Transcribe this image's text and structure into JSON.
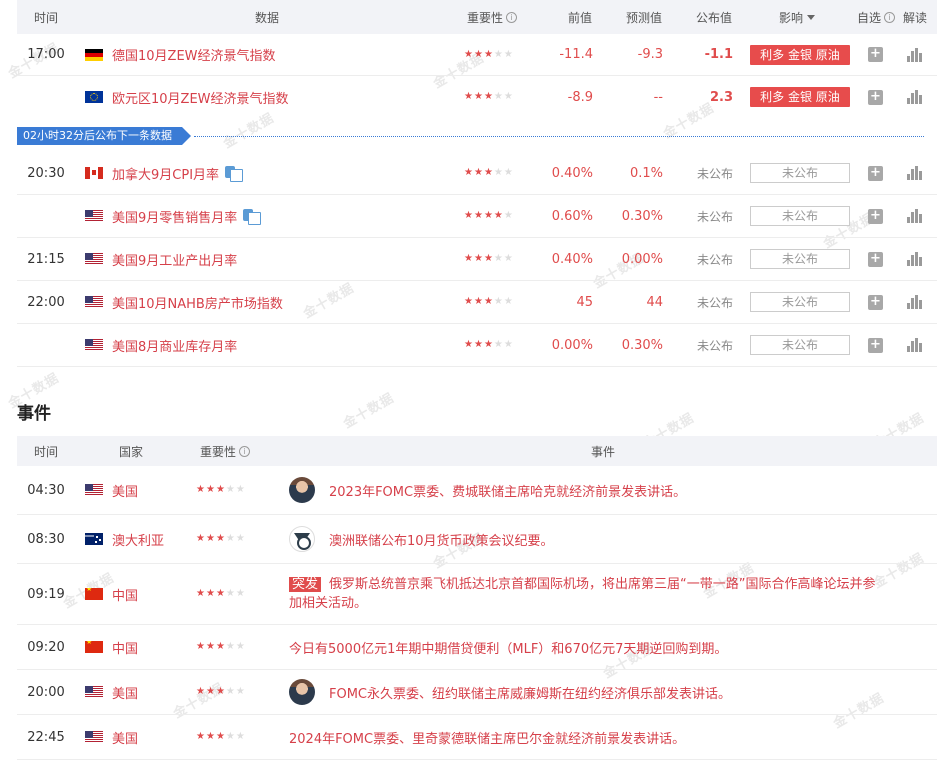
{
  "watermark": "金十数据",
  "data_table": {
    "headers": {
      "time": "时间",
      "data": "数据",
      "importance": "重要性",
      "prev": "前值",
      "forecast": "预测值",
      "actual": "公布值",
      "impact": "影响",
      "watch": "自选",
      "interpret": "解读"
    },
    "rows": [
      {
        "time": "17:00",
        "flag": "de",
        "name": "德国10月ZEW经济景气指数",
        "stars": 3,
        "prev": "-11.4",
        "forecast": "-9.3",
        "actual": "-1.1",
        "impact": "利多 金银 原油",
        "has_doc": false
      },
      {
        "time": "",
        "flag": "eu",
        "name": "欧元区10月ZEW经济景气指数",
        "stars": 3,
        "prev": "-8.9",
        "forecast": "--",
        "actual": "2.3",
        "impact": "利多 金银 原油",
        "has_doc": false
      },
      {
        "time": "20:30",
        "flag": "ca",
        "name": "加拿大9月CPI月率",
        "stars": 3,
        "prev": "0.40%",
        "forecast": "0.1%",
        "actual": "未公布",
        "impact": "未公布",
        "has_doc": true
      },
      {
        "time": "",
        "flag": "us",
        "name": "美国9月零售销售月率",
        "stars": 4,
        "prev": "0.60%",
        "forecast": "0.30%",
        "actual": "未公布",
        "impact": "未公布",
        "has_doc": true
      },
      {
        "time": "21:15",
        "flag": "us",
        "name": "美国9月工业产出月率",
        "stars": 3,
        "prev": "0.40%",
        "forecast": "0.00%",
        "actual": "未公布",
        "impact": "未公布",
        "has_doc": false
      },
      {
        "time": "22:00",
        "flag": "us",
        "name": "美国10月NAHB房产市场指数",
        "stars": 3,
        "prev": "45",
        "forecast": "44",
        "actual": "未公布",
        "impact": "未公布",
        "has_doc": false
      },
      {
        "time": "",
        "flag": "us",
        "name": "美国8月商业库存月率",
        "stars": 3,
        "prev": "0.00%",
        "forecast": "0.30%",
        "actual": "未公布",
        "impact": "未公布",
        "has_doc": false
      }
    ],
    "countdown": "02小时32分后公布下一条数据"
  },
  "events": {
    "title": "事件",
    "headers": {
      "time": "时间",
      "country": "国家",
      "importance": "重要性",
      "event": "事件"
    },
    "rows": [
      {
        "time": "04:30",
        "flag": "us",
        "country": "美国",
        "stars": 3,
        "avatar": "person",
        "flash": "",
        "text": "2023年FOMC票委、费城联储主席哈克就经济前景发表讲话。"
      },
      {
        "time": "08:30",
        "flag": "au",
        "country": "澳大利亚",
        "stars": 3,
        "avatar": "rba",
        "flash": "",
        "text": "澳洲联储公布10月货币政策会议纪要。"
      },
      {
        "time": "09:19",
        "flag": "cn",
        "country": "中国",
        "stars": 3,
        "avatar": "",
        "flash": "突发",
        "text": "俄罗斯总统普京乘飞机抵达北京首都国际机场，将出席第三届“一带一路”国际合作高峰论坛并参",
        "text2": "加相关活动。"
      },
      {
        "time": "09:20",
        "flag": "cn",
        "country": "中国",
        "stars": 3,
        "avatar": "",
        "flash": "",
        "text": "今日有5000亿元1年期中期借贷便利（MLF）和670亿元7天期逆回购到期。"
      },
      {
        "time": "20:00",
        "flag": "us",
        "country": "美国",
        "stars": 3,
        "avatar": "person",
        "flash": "",
        "text": "FOMC永久票委、纽约联储主席威廉姆斯在纽约经济俱乐部发表讲话。"
      },
      {
        "time": "22:45",
        "flag": "us",
        "country": "美国",
        "stars": 3,
        "avatar": "",
        "flash": "",
        "text": "2024年FOMC票委、里奇蒙德联储主席巴尔金就经济前景发表讲话。"
      }
    ]
  },
  "colors": {
    "accent_red": "#e04c4c",
    "countdown_blue": "#3a7bd5",
    "header_bg": "#f2f3f7"
  }
}
